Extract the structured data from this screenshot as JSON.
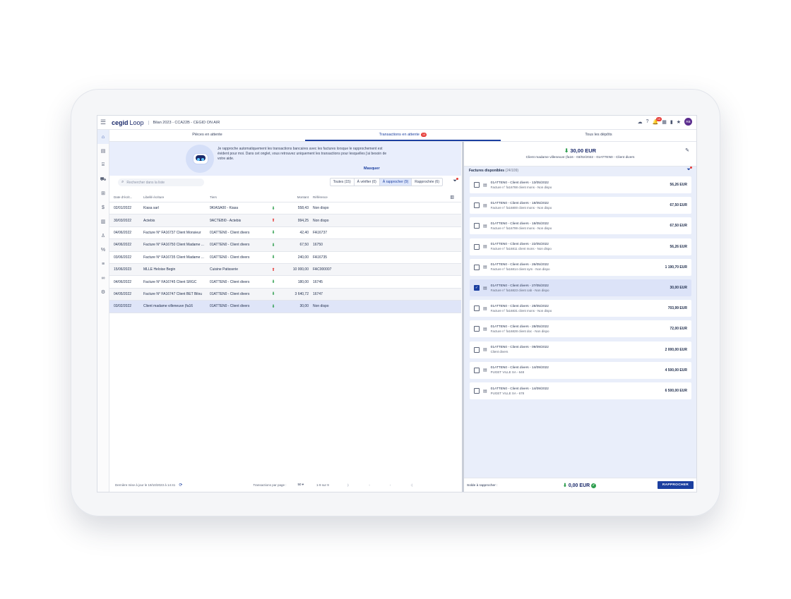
{
  "header": {
    "brand": "cegid",
    "product": "Loop",
    "context": "Bilan 2023 - CCA22B - CEGID ON AIR",
    "notif_count": "10",
    "avatar_initials": "RB"
  },
  "tabs": [
    {
      "label": "Pièces en attente"
    },
    {
      "label": "Transactions en attente",
      "badge": "15"
    },
    {
      "label": "Tous les dépôts"
    }
  ],
  "banner": {
    "text": "Je rapproche automatiquement les transactions bancaires avec les factures lorsque le rapprochement est évident pour moi. Dans cet onglet, vous retrouvez uniquement les transactions pour lesquelles j'ai besoin de votre aide.",
    "hide": "Masquer"
  },
  "search": {
    "placeholder": "Rechercher dans la liste"
  },
  "filters": [
    "Toutes (15)",
    "À vérifier (0)",
    "À rapprocher (9)",
    "Rapprochée (6)"
  ],
  "table": {
    "headers": [
      "Date d'écrit...",
      "Libellé écriture",
      "Tiers",
      "Montant",
      "Référence"
    ],
    "rows": [
      {
        "date": "02/01/2022",
        "lib": "Kiasa sarl",
        "tiers": "9KIASA00 - Kiasa",
        "dir": "down",
        "amount": "558,43",
        "ref": "Non dispo"
      },
      {
        "date": "30/03/2022",
        "lib": "Actebis",
        "tiers": "9ACTEBI0 - Actebis",
        "dir": "up",
        "amount": "994,25",
        "ref": "Non dispo"
      },
      {
        "date": "04/06/2022",
        "lib": "Facture N° FA16737 Client Monsieur",
        "tiers": "01ATTEN0 - Client divers",
        "dir": "down",
        "amount": "42,40",
        "ref": "FA16737"
      },
      {
        "date": "04/06/2022",
        "lib": "Facture N° FA16750 Client Madame ...",
        "tiers": "01ATTEN0 - Client divers",
        "dir": "down",
        "amount": "67,50",
        "ref": "16750"
      },
      {
        "date": "03/06/2022",
        "lib": "Facture N° FA16735 Client Madame ...",
        "tiers": "01ATTEN0 - Client divers",
        "dir": "down",
        "amount": "240,00",
        "ref": "FA16735"
      },
      {
        "date": "15/06/2023",
        "lib": "MLLE Heloise Begin",
        "tiers": "Cuisine Patisserie",
        "dir": "up",
        "amount": "10 000,00",
        "ref": "FAC000007"
      },
      {
        "date": "04/06/2022",
        "lib": "Facture N° FA16745 Client SRGC",
        "tiers": "01ATTEN0 - Client divers",
        "dir": "down",
        "amount": "180,00",
        "ref": "16745"
      },
      {
        "date": "04/05/2022",
        "lib": "Facture N° FA16747 Client BET Bilou",
        "tiers": "01ATTEN0 - Client divers",
        "dir": "down",
        "amount": "3 640,72",
        "ref": "16747"
      },
      {
        "date": "03/02/2022",
        "lib": "Client madame villeneuve (fa16",
        "tiers": "01ATTEN0 - Client divers",
        "dir": "down",
        "amount": "30,00",
        "ref": "Non dispo"
      }
    ]
  },
  "left_footer": {
    "updated": "Dernière mise à jour le 19/10/2023 à 14:41",
    "per_page_label": "Transactions par page :",
    "per_page": "50",
    "range": "1-9 sur 9"
  },
  "detail": {
    "amount": "30,00 EUR",
    "subtitle": "Client madame villeneuve (fa16 - 03/02/2022 - 01ATTEN0 - Client divers",
    "invoices_label": "Factures disponibles",
    "invoices_count": "(24/109)",
    "invoices": [
      {
        "title": "01ATTEN0 - Client divers - 13/05/2022",
        "desc": "Facture n° fa16788 client mons - Non dispo",
        "amount": "56,26 EUR",
        "checked": false
      },
      {
        "title": "01ATTEN0 - Client divers - 18/05/2022",
        "desc": "Facture n° fa16800 client mons - Non dispo",
        "amount": "67,50 EUR",
        "checked": false
      },
      {
        "title": "01ATTEN0 - Client divers - 18/05/2022",
        "desc": "Facture n° fa16799 client mons - Non dispo",
        "amount": "67,50 EUR",
        "checked": false
      },
      {
        "title": "01ATTEN0 - Client divers - 22/05/2022",
        "desc": "Facture n° fa16811 client mons - Non dispo",
        "amount": "56,26 EUR",
        "checked": false
      },
      {
        "title": "01ATTEN0 - Client divers - 26/05/2022",
        "desc": "Facture n° fa16814 client sym - Non dispo",
        "amount": "1 190,70 EUR",
        "checked": false
      },
      {
        "title": "01ATTEN0 - Client divers - 27/05/2022",
        "desc": "Facture n° fa16823 client cab - Non dispo",
        "amount": "30,00 EUR",
        "checked": true
      },
      {
        "title": "01ATTEN0 - Client divers - 28/05/2022",
        "desc": "Facture n° fa16831 client mons - Non dispo",
        "amount": "703,99 EUR",
        "checked": false
      },
      {
        "title": "01ATTEN0 - Client divers - 28/05/2022",
        "desc": "Facture n° fa16828 client doc - Non dispo",
        "amount": "72,00 EUR",
        "checked": false
      },
      {
        "title": "01ATTEN0 - Client divers - 09/09/2022",
        "desc": "Client divers",
        "amount": "2 000,00 EUR",
        "checked": false
      },
      {
        "title": "01ATTEN0 - Client divers - 14/09/2022",
        "desc": "PUGET VILLE SA - 648",
        "amount": "4 500,00 EUR",
        "checked": false
      },
      {
        "title": "01ATTEN0 - Client divers - 14/09/2022",
        "desc": "PUGET VILLE SA - 678",
        "amount": "6 500,00 EUR",
        "checked": false
      }
    ],
    "balance_label": "Solde à rapprocher :",
    "balance": "0,00 EUR",
    "action": "RAPPROCHER"
  }
}
